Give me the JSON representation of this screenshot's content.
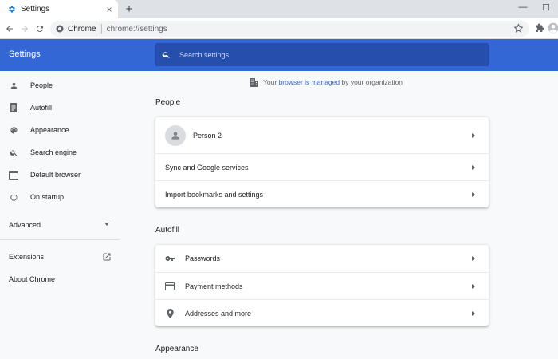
{
  "tab": {
    "title": "Settings",
    "close_label": "×"
  },
  "new_tab_label": "+",
  "window_controls": {
    "minimize": "—",
    "maximize": "☐"
  },
  "omnibox": {
    "site_chip": "Chrome",
    "url": "chrome://settings"
  },
  "header": {
    "title": "Settings",
    "search_placeholder": "Search settings"
  },
  "sidebar": {
    "items": [
      {
        "label": "People",
        "icon": "person-icon"
      },
      {
        "label": "Autofill",
        "icon": "autofill-icon"
      },
      {
        "label": "Appearance",
        "icon": "palette-icon"
      },
      {
        "label": "Search engine",
        "icon": "search-icon"
      },
      {
        "label": "Default browser",
        "icon": "browser-icon"
      },
      {
        "label": "On startup",
        "icon": "power-icon"
      }
    ],
    "advanced": "Advanced",
    "extensions": "Extensions",
    "about": "About Chrome"
  },
  "managed_notice": {
    "prefix": "Your",
    "link": "browser is managed",
    "suffix": "by your organization"
  },
  "sections": {
    "people": {
      "title": "People",
      "rows": [
        "Person 2",
        "Sync and Google services",
        "Import bookmarks and settings"
      ]
    },
    "autofill": {
      "title": "Autofill",
      "rows": [
        "Passwords",
        "Payment methods",
        "Addresses and more"
      ]
    },
    "appearance": {
      "title": "Appearance"
    }
  },
  "colors": {
    "header_blue": "#3367d6",
    "search_bg": "#264fad",
    "link_blue": "#3367d6"
  }
}
